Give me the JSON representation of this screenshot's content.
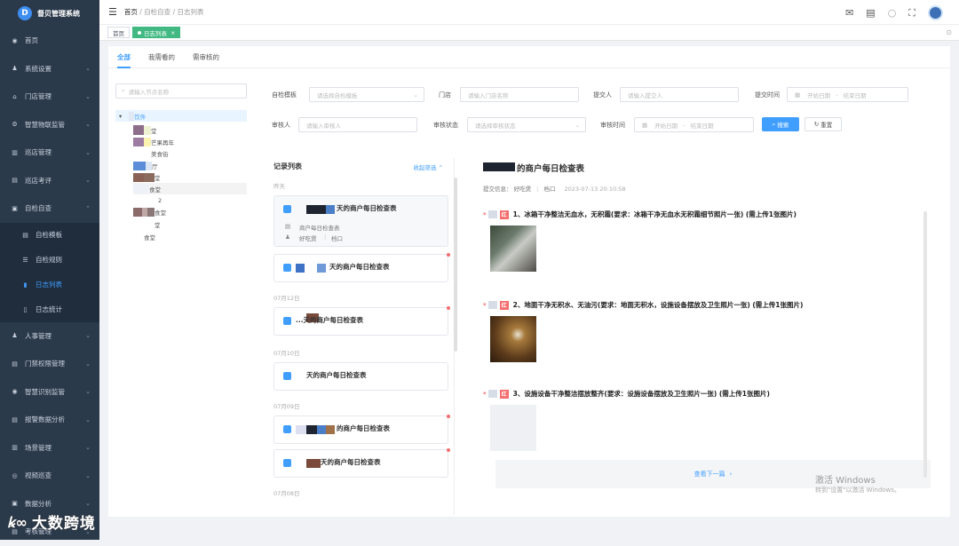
{
  "app": {
    "title": "督贝管理系统"
  },
  "sidebar": {
    "items": [
      {
        "label": "首页",
        "icon": "dashboard-icon"
      },
      {
        "label": "系统设置",
        "icon": "user-icon"
      },
      {
        "label": "门店管理",
        "icon": "store-icon"
      },
      {
        "label": "智慧物联监管",
        "icon": "gear-icon"
      },
      {
        "label": "巡店管理",
        "icon": "grid-icon"
      },
      {
        "label": "巡店考评",
        "icon": "clipboard-icon"
      },
      {
        "label": "自检自查",
        "icon": "checklist-icon"
      }
    ],
    "subitems": [
      {
        "label": "自检模板",
        "icon": "template-icon"
      },
      {
        "label": "自检规则",
        "icon": "list-icon"
      },
      {
        "label": "日志列表",
        "icon": "bar-chart-icon"
      },
      {
        "label": "日志统计",
        "icon": "stats-icon"
      }
    ],
    "more": [
      {
        "label": "人事管理",
        "icon": "person-icon"
      },
      {
        "label": "门禁权限管理",
        "icon": "door-icon"
      },
      {
        "label": "智慧识别监管",
        "icon": "eye-icon"
      },
      {
        "label": "报警数据分析",
        "icon": "report-icon"
      },
      {
        "label": "场景管理",
        "icon": "scene-icon"
      },
      {
        "label": "视频巡查",
        "icon": "video-icon"
      },
      {
        "label": "数据分析",
        "icon": "data-icon"
      },
      {
        "label": "考核管理",
        "icon": "exam-icon"
      }
    ]
  },
  "breadcrumb": [
    "首页",
    "自检自查",
    "日志列表"
  ],
  "tags": [
    "首页",
    "日志列表"
  ],
  "tabs": [
    "全部",
    "我需看的",
    "需审核的"
  ],
  "tree": {
    "search_placeholder": "请输入节点名称",
    "root": "饮件",
    "nodes": [
      "堂",
      "芒果再年",
      "美食街",
      "厅",
      "堂",
      "食堂",
      "2",
      "食堂",
      "堂",
      "食堂"
    ]
  },
  "filters": {
    "template_label": "自检模板",
    "template_ph": "请选择自检模板",
    "store_label": "门店",
    "store_ph": "请输入门店名称",
    "submitter_label": "提交人",
    "submitter_ph": "请输入提交人",
    "submit_time_label": "提交时间",
    "start_ph": "开始日期",
    "end_ph": "结束日期",
    "reviewer_label": "审核人",
    "reviewer_ph": "请输入审核人",
    "status_label": "审核状态",
    "status_ph": "请选择审核状态",
    "review_time_label": "审核时间",
    "start_ph2": "开始日期",
    "end_ph2": "结束日期",
    "search_btn": "搜索",
    "reset_btn": "重置"
  },
  "records": {
    "title": "记录列表",
    "collapse": "收起筛选",
    "groups": [
      {
        "date": "昨天",
        "cards": [
          {
            "title": "天的商户每日检查表",
            "template": "商户每日检查表",
            "user": "好吃煲",
            "store": "档口"
          },
          {
            "title": "天的商户每日检查表"
          }
        ]
      },
      {
        "date": "07月12日",
        "cards": [
          {
            "title": "...天的商户每日检查表"
          }
        ]
      },
      {
        "date": "07月10日",
        "cards": [
          {
            "title": "天的商户每日检查表"
          }
        ]
      },
      {
        "date": "07月09日",
        "cards": [
          {
            "title": "的商户每日检查表"
          },
          {
            "title": "天的商户每日检查表"
          }
        ]
      },
      {
        "date": "07月08日",
        "cards": []
      }
    ]
  },
  "detail": {
    "title": "的商户每日检查表",
    "submit_label": "提交信息：",
    "user": "好吃煲",
    "store": "档口",
    "time": "2023-07-13 20:10:58",
    "badge": "红",
    "questions": [
      "1、冰箱干净整洁无血水，无积霜(要求：冰箱干净无血水无积霜细节照片一张) (需上传1张图片)",
      "2、地面干净无积水、无油污(要求：地面无积水，设施设备摆放及卫生照片一张) (需上传1张图片)",
      "3、设施设备干净整洁摆放整齐(要求：设施设备摆放及卫生照片一张) (需上传1张图片)"
    ],
    "next": "查看下一篇"
  },
  "watermark": {
    "line1": "激活 Windows",
    "line2": "转到\"设置\"以激活 Windows。"
  },
  "brand": "大数跨境"
}
